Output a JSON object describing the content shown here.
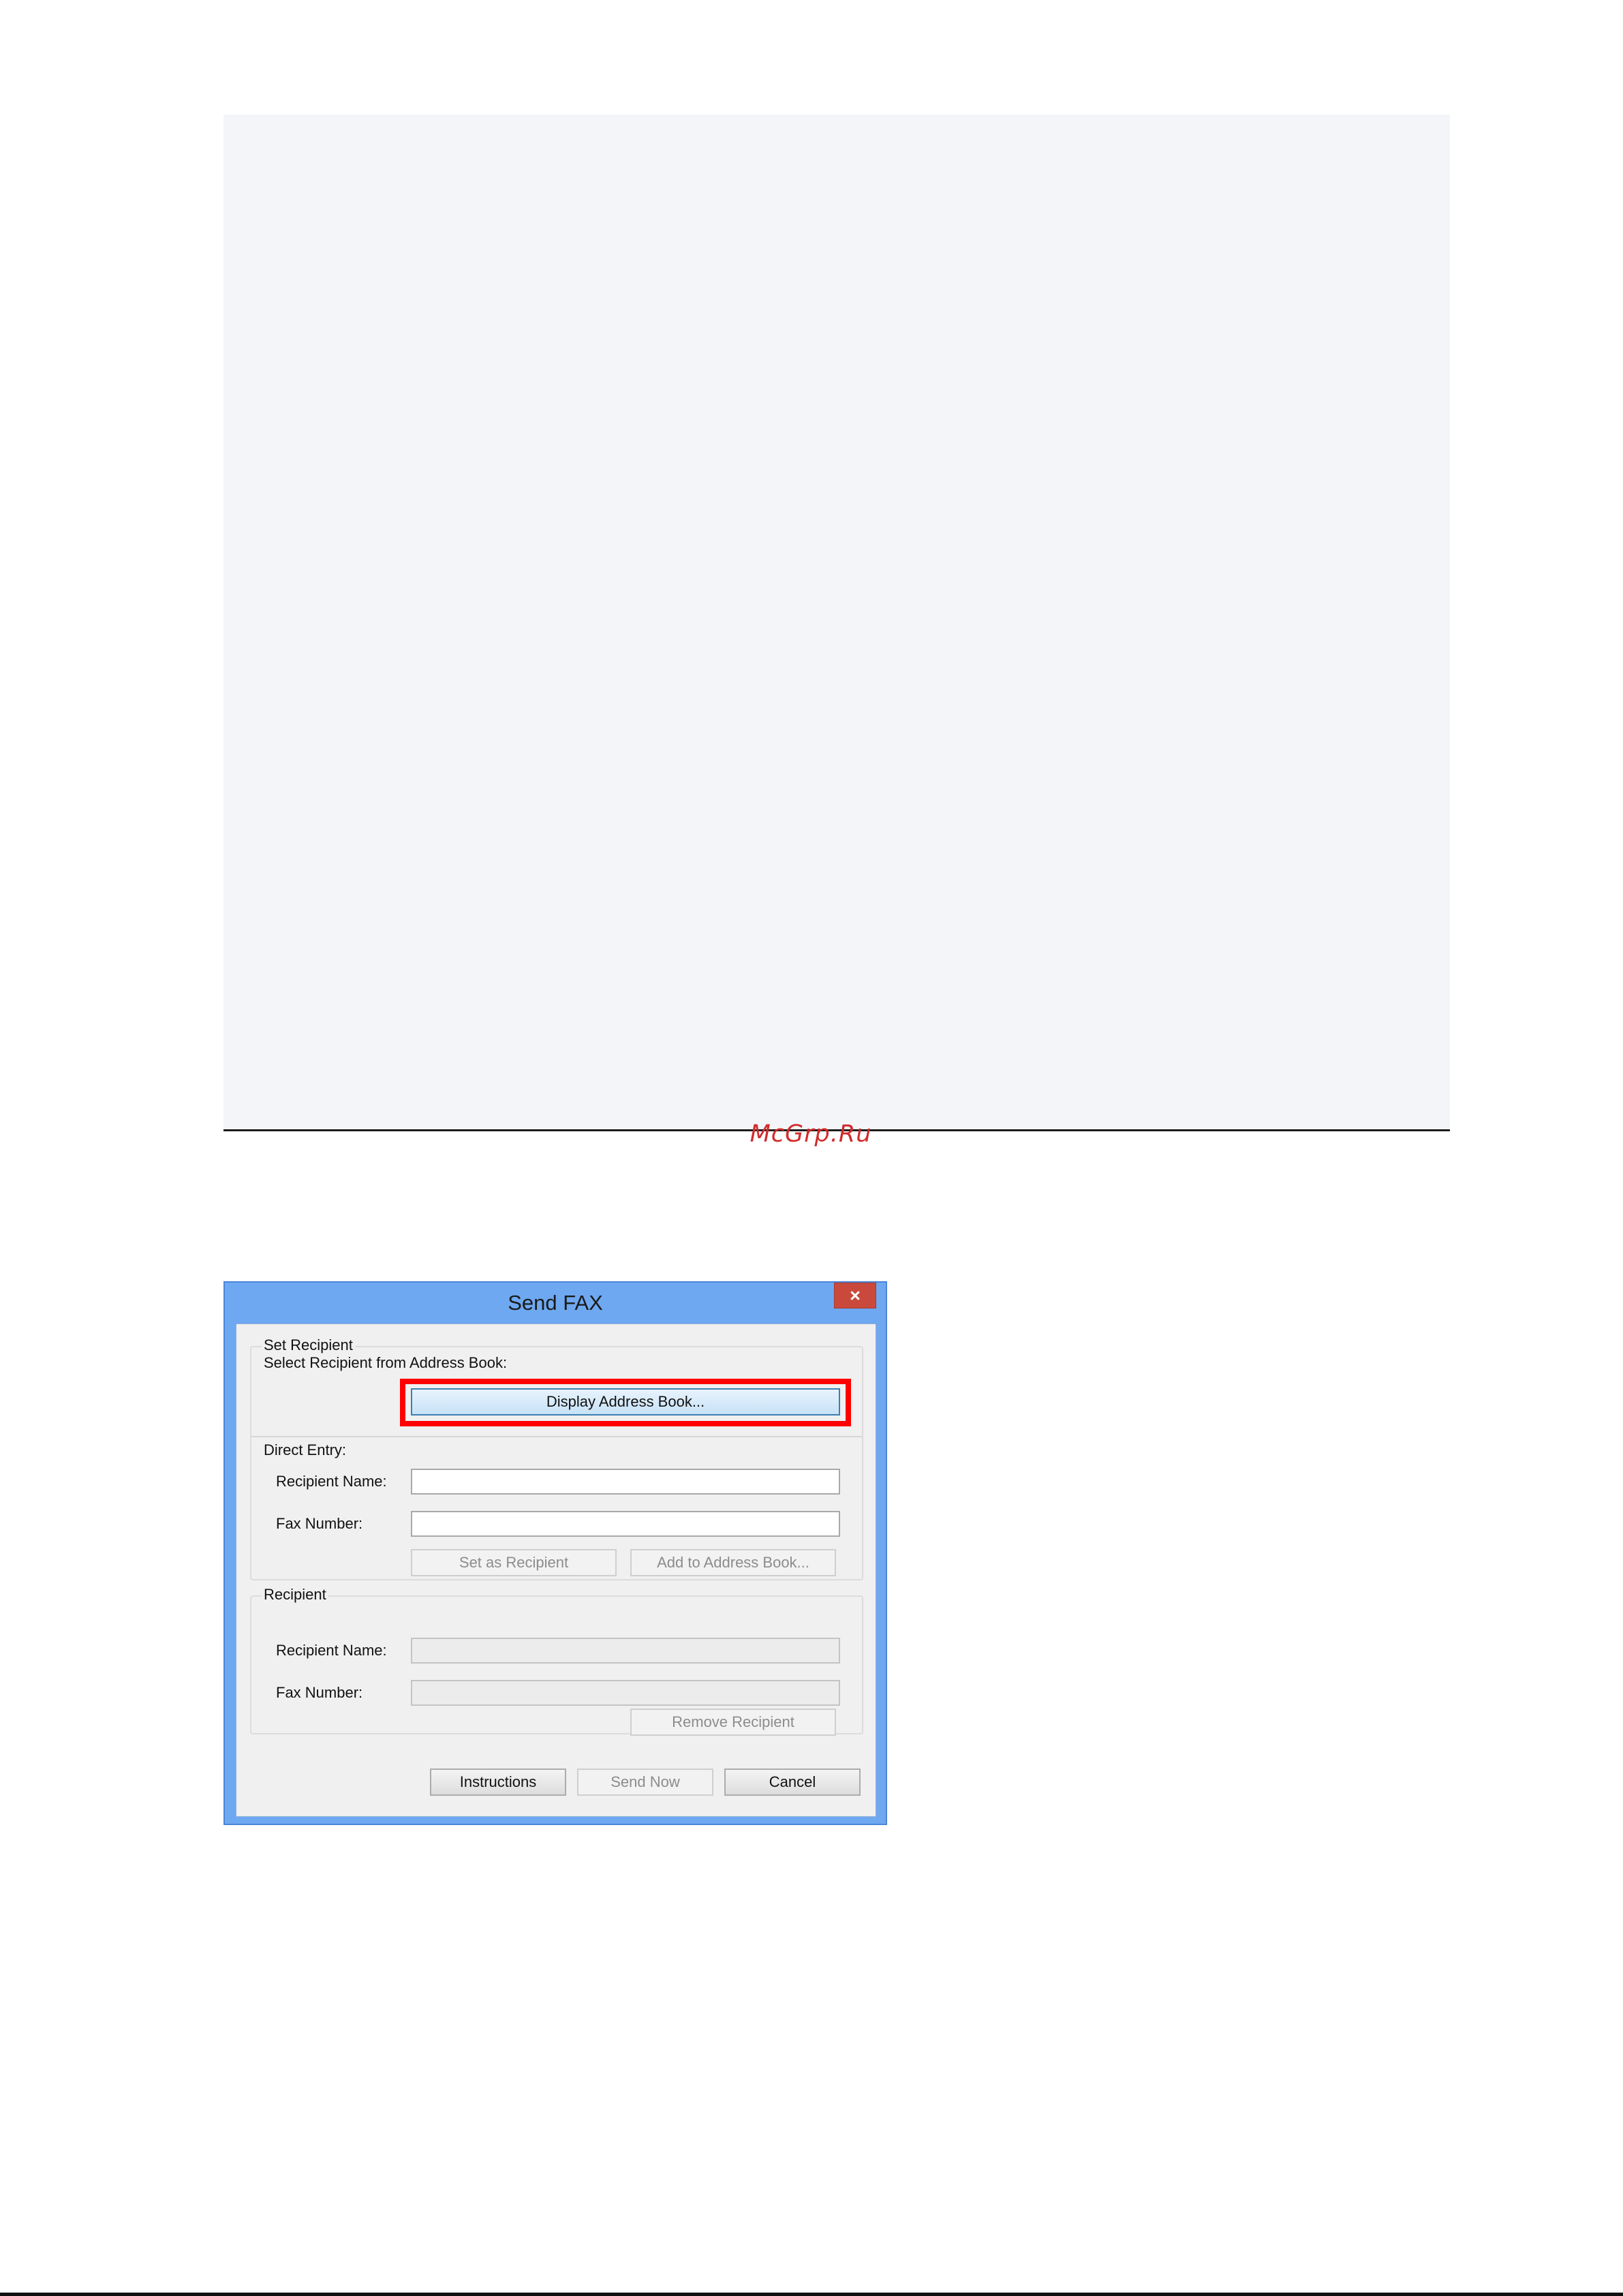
{
  "watermark": "McGrp.Ru",
  "dialog": {
    "title": "Send FAX",
    "close_glyph": "×",
    "set_recipient": {
      "group_label": "Set Recipient",
      "address_book_label": "Select Recipient from Address Book:",
      "display_address_book_button": "Display Address Book...",
      "direct_entry_label": "Direct Entry:",
      "recipient_name_label": "Recipient Name:",
      "recipient_name_value": "",
      "fax_number_label": "Fax Number:",
      "fax_number_value": "",
      "set_as_recipient_button": "Set as Recipient",
      "add_to_address_book_button": "Add to Address Book..."
    },
    "recipient": {
      "group_label": "Recipient",
      "recipient_name_label": "Recipient Name:",
      "fax_number_label": "Fax Number:",
      "remove_recipient_button": "Remove Recipient"
    },
    "footer": {
      "instructions_button": "Instructions",
      "send_now_button": "Send Now",
      "cancel_button": "Cancel"
    }
  },
  "colors": {
    "highlight": "#ff0000",
    "titlebar": "#6ea8f1",
    "close_button": "#c94a3c",
    "watermark": "#d12b2b"
  }
}
